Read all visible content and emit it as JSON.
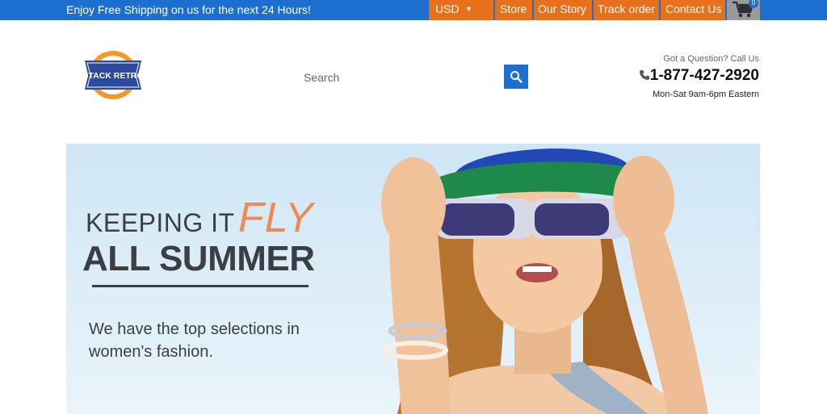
{
  "topbar": {
    "promo": "Enjoy Free Shipping on us for the next 24 Hours!",
    "currency": "USD",
    "nav": [
      "Store",
      "Our Story",
      "Track order",
      "Contact Us"
    ],
    "cart_count": "0"
  },
  "header": {
    "logo_text": "STACK RETRO",
    "search_placeholder": "Search",
    "question": "Got a Question? Call Us",
    "phone": "1-877-427-2920",
    "hours": "Mon-Sat 9am-6pm Eastern"
  },
  "hero": {
    "line1": "KEEPING IT",
    "fly": "FLY",
    "line2": "ALL SUMMER",
    "subtitle": "We have the top selections in women's fashion."
  },
  "colors": {
    "brand_blue": "#1d6fcf",
    "accent_orange": "#e8701a",
    "fly_orange": "#f08a55"
  }
}
